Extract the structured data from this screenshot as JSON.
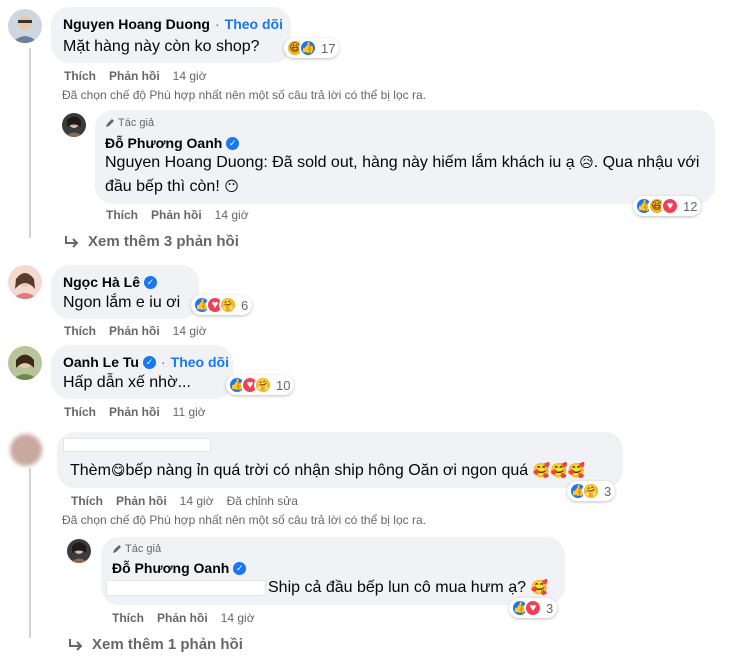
{
  "c1": {
    "name": "Nguyen Hoang Duong",
    "sep": "·",
    "follow": "Theo dõi",
    "text": "Mặt hàng này còn ko shop?",
    "react_count": "17",
    "like": "Thích",
    "reply": "Phản hồi",
    "time": "14 giờ",
    "notice": "Đã chọn chế độ Phù hợp nhất nên một số câu trả lời có thể bị lọc ra."
  },
  "r1": {
    "author_tag": "Tác giả",
    "name": "Đỗ Phương Oanh",
    "mention": "Nguyen Hoang Duong",
    "text_a": ": Đã sold out, hàng này hiếm lắm khách iu ạ",
    "text_b": ". Qua nhậu với đầu bếp thì còn!",
    "react_count": "12",
    "like": "Thích",
    "reply": "Phản hồi",
    "time": "14 giờ"
  },
  "more1": "Xem thêm 3 phản hồi",
  "c2": {
    "name": "Ngọc Hà Lê",
    "text": "Ngon lắm e iu ơi",
    "react_count": "6",
    "like": "Thích",
    "reply": "Phản hồi",
    "time": "14 giờ"
  },
  "c3": {
    "name": "Oanh Le Tu",
    "sep": "·",
    "follow": "Theo dõi",
    "text": "Hấp dẫn xế nhờ...",
    "react_count": "10",
    "like": "Thích",
    "reply": "Phản hồi",
    "time": "11 giờ"
  },
  "c4": {
    "text_a": "Thèm",
    "text_b": "bếp nàng ỉn quá trời có nhận ship hông Oăn ơi ngon quá",
    "react_count": "3",
    "like": "Thích",
    "reply": "Phản hồi",
    "time": "14 giờ",
    "edited": "Đã chỉnh sửa",
    "notice": "Đã chọn chế độ Phù hợp nhất nên một số câu trả lời có thể bị lọc ra."
  },
  "r2": {
    "author_tag": "Tác giả",
    "name": "Đỗ Phương Oanh",
    "text": "Ship cả đầu bếp lun cô mua hưm ạ?",
    "react_count": "3",
    "like": "Thích",
    "reply": "Phản hồi",
    "time": "14 giờ"
  },
  "more2": "Xem thêm 1 phản hồi",
  "colors": {
    "accent": "#1877f2",
    "bubble": "#f0f2f5",
    "meta": "#65676b"
  },
  "icons": [
    "like-icon",
    "love-icon",
    "haha-icon",
    "care-icon",
    "verified-icon",
    "reply-arrow-icon",
    "pen-icon"
  ]
}
